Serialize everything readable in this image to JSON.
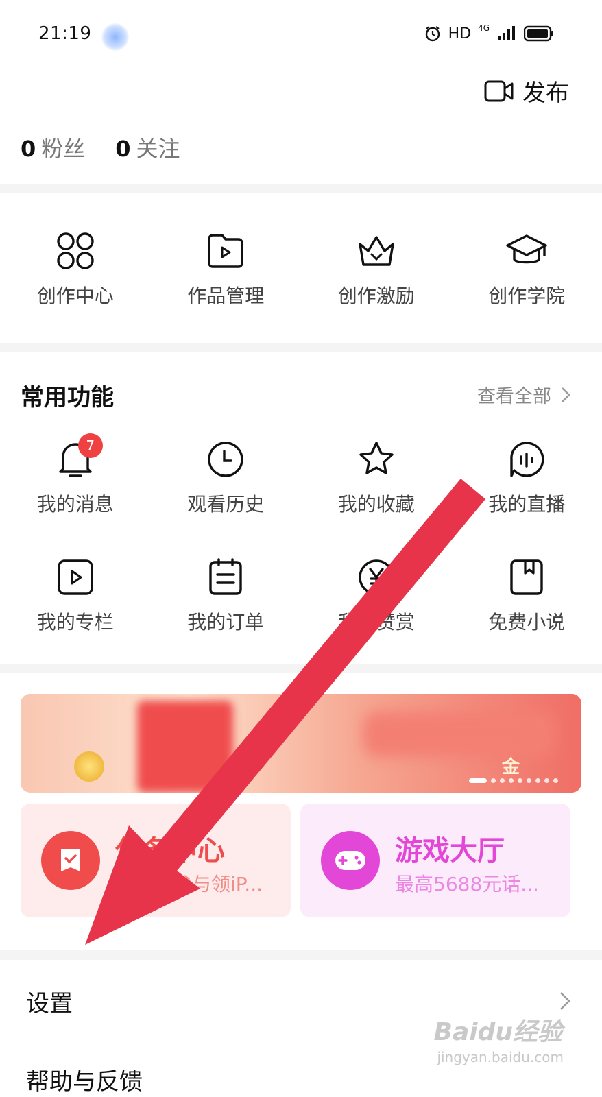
{
  "status_bar": {
    "time": "21:19",
    "network": "HD",
    "signal": "4G"
  },
  "header": {
    "publish_label": "发布"
  },
  "stats": [
    {
      "value": "0",
      "label": "粉丝"
    },
    {
      "value": "0",
      "label": "关注"
    }
  ],
  "creator": [
    {
      "label": "创作中心",
      "icon": "grid-icon"
    },
    {
      "label": "作品管理",
      "icon": "video-folder-icon"
    },
    {
      "label": "创作激励",
      "icon": "crown-icon"
    },
    {
      "label": "创作学院",
      "icon": "graduation-cap-icon"
    }
  ],
  "common": {
    "title": "常用功能",
    "view_all": "查看全部",
    "row1": [
      {
        "label": "我的消息",
        "icon": "bell-icon",
        "badge": "7"
      },
      {
        "label": "观看历史",
        "icon": "clock-icon"
      },
      {
        "label": "我的收藏",
        "icon": "star-icon"
      },
      {
        "label": "我的直播",
        "icon": "live-icon"
      }
    ],
    "row2": [
      {
        "label": "我的专栏",
        "icon": "play-square-icon"
      },
      {
        "label": "我的订单",
        "icon": "clipboard-icon"
      },
      {
        "label": "我的赞赏",
        "icon": "yen-coin-icon"
      },
      {
        "label": "免费小说",
        "icon": "book-icon"
      }
    ]
  },
  "banner": {
    "text": "金"
  },
  "cards": [
    {
      "title": "任务中心",
      "subtitle": "做任务参与领iP...",
      "icon": "ticket-check-icon",
      "color": "#f04c4c"
    },
    {
      "title": "游戏大厅",
      "subtitle": "最高5688元话...",
      "icon": "gamepad-icon",
      "color": "#e347d8"
    }
  ],
  "menu": [
    {
      "label": "设置"
    },
    {
      "label": "帮助与反馈"
    }
  ],
  "watermark": {
    "brand": "Baidu经验",
    "url": "jingyan.baidu.com"
  }
}
